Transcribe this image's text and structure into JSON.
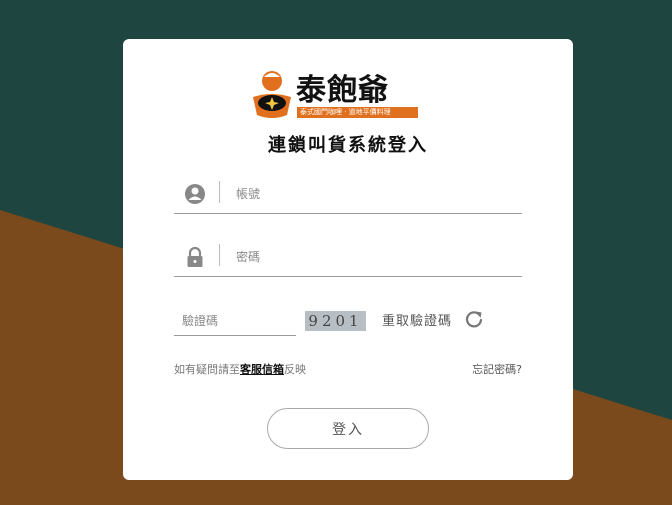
{
  "brand": {
    "name": "泰飽爺",
    "tagline": "泰式國門咖哩 · 道地平價料理"
  },
  "title": "連鎖叫貨系統登入",
  "form": {
    "account_placeholder": "帳號",
    "password_placeholder": "密碼",
    "captcha_placeholder": "驗證碼",
    "captcha_code": "9201",
    "reload_label": "重取驗證碼"
  },
  "help": {
    "prefix": "如有疑問請至",
    "link": "客服信箱",
    "suffix": "反映"
  },
  "forgot_label": "忘記密碼?",
  "login_label": "登入",
  "colors": {
    "background_top": "#1f4540",
    "background_bottom": "#7a4a1c",
    "brand_orange": "#e0701e"
  }
}
